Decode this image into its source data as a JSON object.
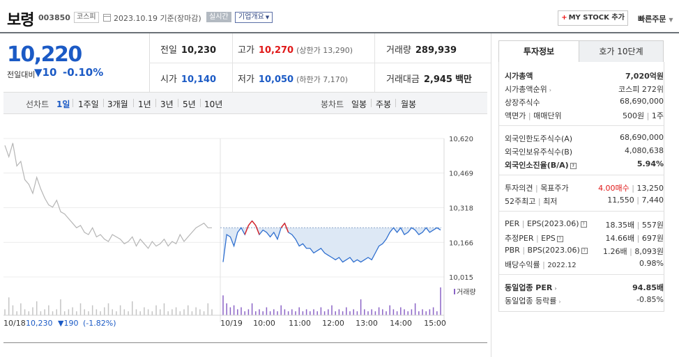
{
  "header": {
    "stock_name": "보령",
    "stock_code": "003850",
    "market_badge": "코스피",
    "date_text": "2023.10.19 기준(장마감)",
    "realtime_badge": "실시간",
    "company_overview": "기업개요",
    "my_stock_label": "MY STOCK 추가",
    "quick_order": "빠른주문"
  },
  "price": {
    "current": "10,220",
    "change_label": "전일대비",
    "change_arrow": "▼",
    "change": "10",
    "change_pct": "-0.10%"
  },
  "quote": {
    "prev_close_label": "전일",
    "prev_close": "10,230",
    "high_label": "고가",
    "high": "10,270",
    "upper_limit": "(상한가 13,290)",
    "volume_label": "거래량",
    "volume": "289,939",
    "open_label": "시가",
    "open": "10,140",
    "low_label": "저가",
    "low": "10,050",
    "lower_limit": "(하한가 7,170)",
    "amount_label": "거래대금",
    "amount": "2,945",
    "amount_unit": "백만"
  },
  "chart_tabs": {
    "line_label": "선차트",
    "periods": [
      "1일",
      "1주일",
      "3개월",
      "1년",
      "3년",
      "5년",
      "10년"
    ],
    "candle_label": "봉차트",
    "candles": [
      "일봉",
      "주봉",
      "월봉"
    ]
  },
  "chart_data": {
    "type": "line",
    "y_ticks": [
      "10,620",
      "10,469",
      "10,318",
      "10,166",
      "10,015"
    ],
    "ylim": [
      10015,
      10620
    ],
    "x_ticks": [
      "10/19",
      "10:00",
      "11:00",
      "12:00",
      "13:00",
      "14:00",
      "15:00"
    ],
    "prev_day_label": "10/18",
    "prev_day_close": "10,230",
    "prev_day_change": "▼190",
    "prev_day_pct": "(-1.82%)",
    "volume_legend": "거래량",
    "reference_price": 10230,
    "prev_day_series": [
      10590,
      10540,
      10600,
      10500,
      10520,
      10440,
      10420,
      10380,
      10450,
      10400,
      10360,
      10330,
      10320,
      10350,
      10300,
      10290,
      10270,
      10250,
      10230,
      10240,
      10210,
      10200,
      10230,
      10190,
      10200,
      10180,
      10170,
      10200,
      10190,
      10180,
      10160,
      10170,
      10190,
      10150,
      10180,
      10160,
      10140,
      10170,
      10150,
      10160,
      10180,
      10150,
      10170,
      10160,
      10200,
      10170,
      10190,
      10210,
      10230,
      10240,
      10250,
      10230,
      10230
    ],
    "today_series": [
      10080,
      10200,
      10190,
      10150,
      10210,
      10230,
      10200,
      10240,
      10260,
      10240,
      10200,
      10220,
      10210,
      10190,
      10210,
      10180,
      10230,
      10250,
      10210,
      10200,
      10180,
      10150,
      10160,
      10140,
      10140,
      10120,
      10130,
      10140,
      10120,
      10110,
      10100,
      10090,
      10100,
      10080,
      10090,
      10100,
      10080,
      10090,
      10080,
      10090,
      10100,
      10090,
      10120,
      10150,
      10160,
      10180,
      10210,
      10230,
      10210,
      10230,
      10200,
      10210,
      10230,
      10220,
      10200,
      10210,
      10230,
      10210,
      10220,
      10230,
      10220
    ],
    "prev_volume": [
      3,
      9,
      5,
      2,
      6,
      3,
      2,
      4,
      7,
      2,
      3,
      5,
      2,
      3,
      8,
      2,
      3,
      4,
      2,
      6,
      3,
      2,
      5,
      3,
      2,
      4,
      6,
      3,
      2,
      5,
      3,
      2,
      7,
      3,
      2,
      4,
      3,
      2,
      5,
      3,
      6,
      2,
      3,
      4,
      2,
      3,
      5,
      2,
      4,
      3,
      2,
      6,
      3
    ],
    "today_volume": [
      10,
      6,
      4,
      5,
      3,
      4,
      2,
      3,
      6,
      2,
      3,
      2,
      4,
      2,
      3,
      2,
      5,
      3,
      2,
      3,
      2,
      4,
      2,
      3,
      2,
      3,
      2,
      4,
      2,
      3,
      5,
      2,
      3,
      2,
      4,
      2,
      3,
      2,
      8,
      3,
      2,
      3,
      2,
      4,
      3,
      2,
      5,
      3,
      2,
      4,
      3,
      2,
      3,
      6,
      2,
      3,
      2,
      3,
      4,
      2,
      14
    ]
  },
  "right_panel": {
    "tab_invest": "투자정보",
    "tab_hoga": "호가 10단계",
    "market_cap_label": "시가총액",
    "market_cap": "7,020억원",
    "cap_rank_label": "시가총액순위",
    "cap_rank": "코스피 272위",
    "listed_shares_label": "상장주식수",
    "listed_shares": "68,690,000",
    "par_label": "액면가",
    "trade_unit_label": "매매단위",
    "par_value": "500원",
    "trade_unit": "1주",
    "foreign_limit_label": "외국인한도주식수(A)",
    "foreign_limit": "68,690,000",
    "foreign_hold_label": "외국인보유주식수(B)",
    "foreign_hold": "4,080,638",
    "foreign_ratio_label": "외국인소진율(B/A)",
    "foreign_ratio": "5.94%",
    "opinion_label": "투자의견",
    "target_label": "목표주가",
    "opinion_value": "4.00매수",
    "target_value": "13,250",
    "high52_label": "52주최고",
    "low52_label": "최저",
    "high52": "11,550",
    "low52": "7,440",
    "per_label": "PER",
    "eps_label": "EPS(2023.06)",
    "per_value": "18.35배",
    "eps_value": "557원",
    "est_per_label": "추정PER",
    "est_eps_label": "EPS",
    "est_per_value": "14.66배",
    "est_eps_value": "697원",
    "pbr_label": "PBR",
    "bps_label": "BPS(2023.06)",
    "pbr_value": "1.26배",
    "bps_value": "8,093원",
    "div_label": "배당수익률",
    "div_date": "2022.12",
    "div_value": "0.98%",
    "sector_per_label": "동일업종 PER",
    "sector_per": "94.85배",
    "sector_chg_label": "동일업종 등락률",
    "sector_chg": "-0.85%"
  }
}
